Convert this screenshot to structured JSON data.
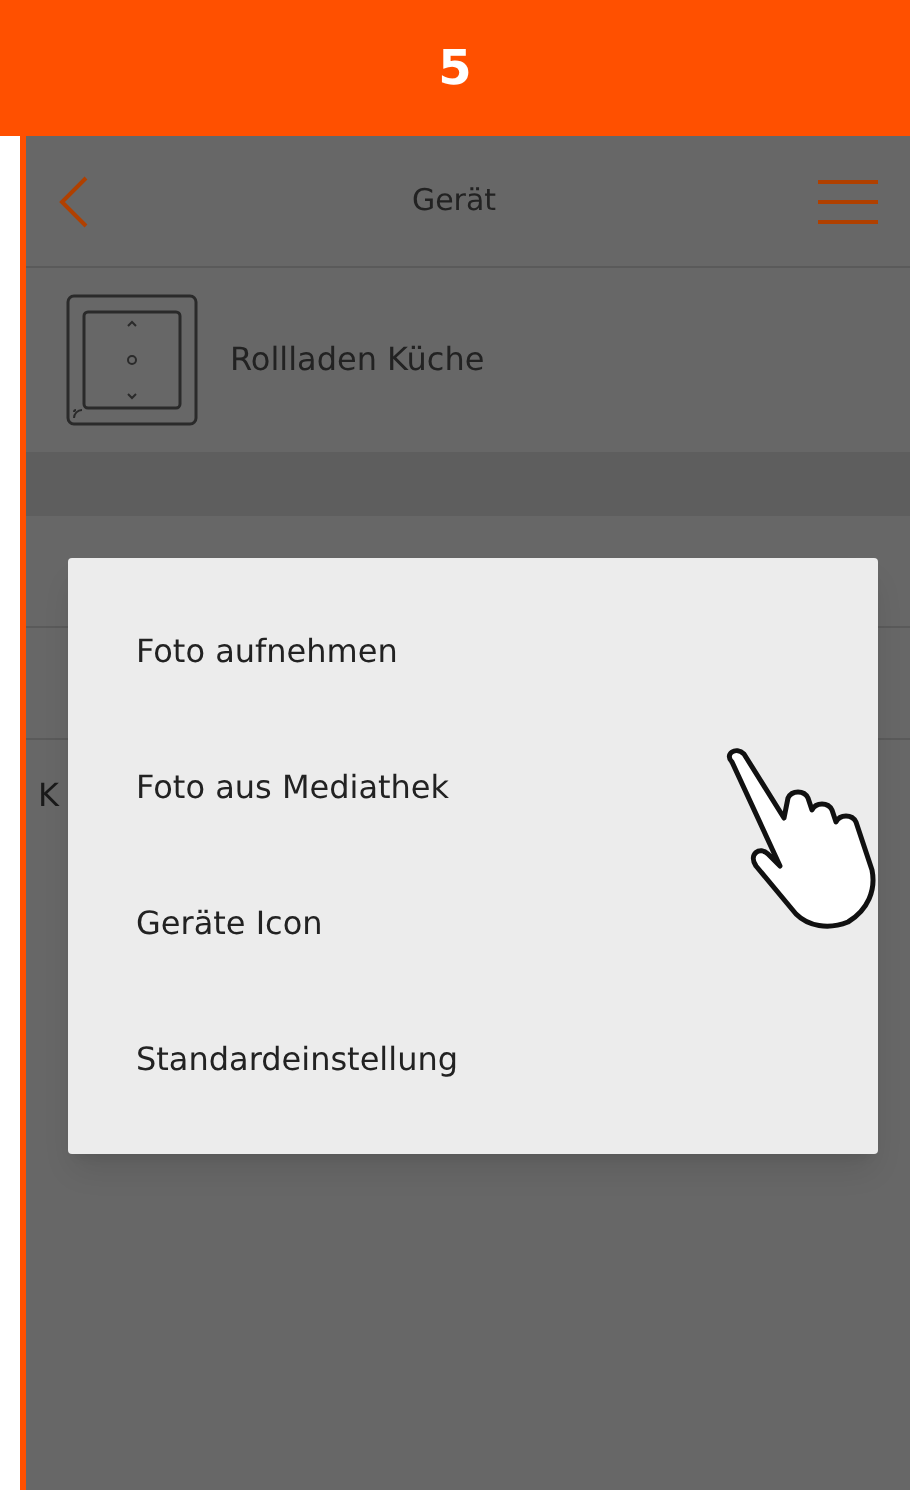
{
  "step": "5",
  "header": {
    "title": "Gerät"
  },
  "device": {
    "name": "Rollladen Küche"
  },
  "background_rows": [
    "K"
  ],
  "menu": {
    "items": [
      "Foto aufnehmen",
      "Foto aus Mediathek",
      "Geräte Icon",
      "Standardeinstellung"
    ]
  }
}
